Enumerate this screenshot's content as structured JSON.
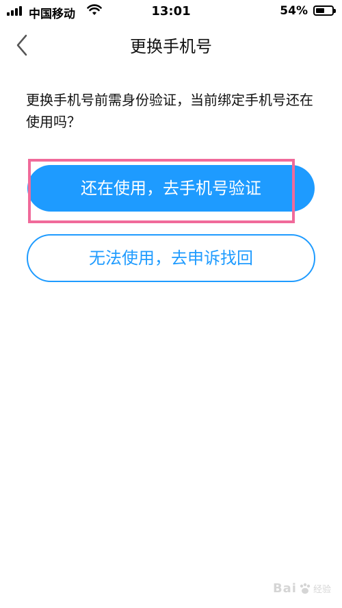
{
  "status_bar": {
    "carrier": "中国移动",
    "time": "13:01",
    "battery_percent": "54%",
    "battery_level": 0.54,
    "icons": [
      "signal-icon",
      "wifi-icon",
      "battery-icon"
    ]
  },
  "nav": {
    "back_icon": "chevron-left-icon",
    "title": "更换手机号"
  },
  "prompt": "更换手机号前需身份验证，当前绑定手机号还在使用吗？",
  "buttons": {
    "primary_label": "还在使用，去手机号验证",
    "secondary_label": "无法使用，去申诉找回"
  },
  "watermark": {
    "text": "Bai",
    "sub": "经验"
  },
  "colors": {
    "accent": "#1e9bff",
    "highlight": "#f06a9a",
    "text": "#111111",
    "background": "#ffffff"
  }
}
